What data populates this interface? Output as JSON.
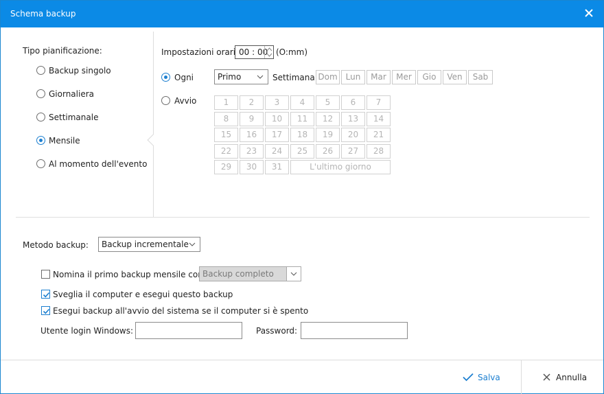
{
  "window": {
    "title": "Schema backup"
  },
  "schedule_type": {
    "label": "Tipo pianificazione:",
    "options": [
      {
        "label": "Backup singolo",
        "checked": false
      },
      {
        "label": "Giornaliera",
        "checked": false
      },
      {
        "label": "Settimanale",
        "checked": false
      },
      {
        "label": "Mensile",
        "checked": true
      },
      {
        "label": "Al momento dell'evento",
        "checked": false
      }
    ]
  },
  "time": {
    "label": "Impostazioni orario",
    "value": "00 : 00",
    "format": "(O:mm)"
  },
  "every": {
    "label": "Ogni",
    "checked": true,
    "ordinal_value": "Primo",
    "week_label": "Settimana",
    "weekdays": [
      "Dom",
      "Lun",
      "Mar",
      "Mer",
      "Gio",
      "Ven",
      "Sab"
    ]
  },
  "on_day": {
    "label": "Avvio",
    "checked": false,
    "days": [
      "1",
      "2",
      "3",
      "4",
      "5",
      "6",
      "7",
      "8",
      "9",
      "10",
      "11",
      "12",
      "13",
      "14",
      "15",
      "16",
      "17",
      "18",
      "19",
      "20",
      "21",
      "22",
      "23",
      "24",
      "25",
      "26",
      "27",
      "28",
      "29",
      "30",
      "31"
    ],
    "last_day_label": "L'ultimo giorno"
  },
  "method": {
    "label": "Metodo backup:",
    "value": "Backup incrementale"
  },
  "options": {
    "first_full": {
      "label": "Nomina il primo backup mensile come",
      "checked": false,
      "value": "Backup completo"
    },
    "wake": {
      "label": "Sveglia il computer e esegui questo backup",
      "checked": true
    },
    "run_at_boot": {
      "label": "Esegui backup all'avvio del sistema se il computer si è spento",
      "checked": true
    }
  },
  "credentials": {
    "user_label": "Utente login Windows:",
    "user_value": "",
    "password_label": "Password:",
    "password_value": ""
  },
  "footer": {
    "save_label": "Salva",
    "cancel_label": "Annulla"
  },
  "colors": {
    "accent": "#0b8ae6",
    "save_text": "#1c7fd0"
  }
}
